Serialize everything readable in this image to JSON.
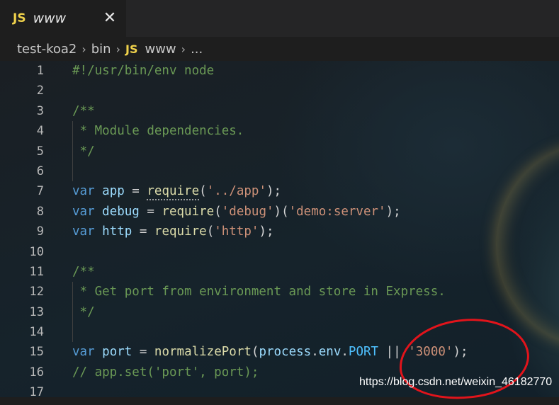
{
  "tab": {
    "lang_badge": "JS",
    "file_name": "www",
    "close_glyph": "✕"
  },
  "breadcrumb": {
    "items": [
      "test-koa2",
      "bin",
      "www",
      "..."
    ],
    "lang_badge": "JS",
    "separator": "›"
  },
  "gutter": {
    "line_numbers": [
      "1",
      "2",
      "3",
      "4",
      "5",
      "6",
      "7",
      "8",
      "9",
      "10",
      "11",
      "12",
      "13",
      "14",
      "15",
      "16",
      "17"
    ]
  },
  "code": {
    "l1": "#!/usr/bin/env node",
    "l3": "/**",
    "l4": " * Module dependencies.",
    "l5": " */",
    "l7_kw": "var",
    "l7_name": "app",
    "l7_eq": " = ",
    "l7_fn": "require",
    "l7_open": "(",
    "l7_str": "'../app'",
    "l7_close": ");",
    "l8_kw": "var",
    "l8_name": "debug",
    "l8_eq": " = ",
    "l8_fn": "require",
    "l8_open": "(",
    "l8_str1": "'debug'",
    "l8_mid": ")(",
    "l8_str2": "'demo:server'",
    "l8_close": ");",
    "l9_kw": "var",
    "l9_name": "http",
    "l9_eq": " = ",
    "l9_fn": "require",
    "l9_open": "(",
    "l9_str": "'http'",
    "l9_close": ");",
    "l11": "/**",
    "l12": " * Get port from environment and store in Express.",
    "l13": " */",
    "l15_kw": "var",
    "l15_name": "port",
    "l15_eq": " = ",
    "l15_fn": "normalizePort",
    "l15_open": "(",
    "l15_obj": "process",
    "l15_dot1": ".",
    "l15_prop": "env",
    "l15_dot2": ".",
    "l15_const": "PORT",
    "l15_or": " || ",
    "l15_str": "'3000'",
    "l15_close": ");",
    "l16": "// app.set('port', port);"
  },
  "watermark": "https://blog.csdn.net/weixin_46182770",
  "colors": {
    "keyword": "#569cd6",
    "variable": "#9cdcfe",
    "function": "#dcdcaa",
    "string": "#ce9178",
    "comment": "#6a9955",
    "constant": "#4fc1ff",
    "annotation": "#e2141b"
  },
  "icons": {
    "tab_close": "close-icon",
    "language": "javascript-icon"
  }
}
